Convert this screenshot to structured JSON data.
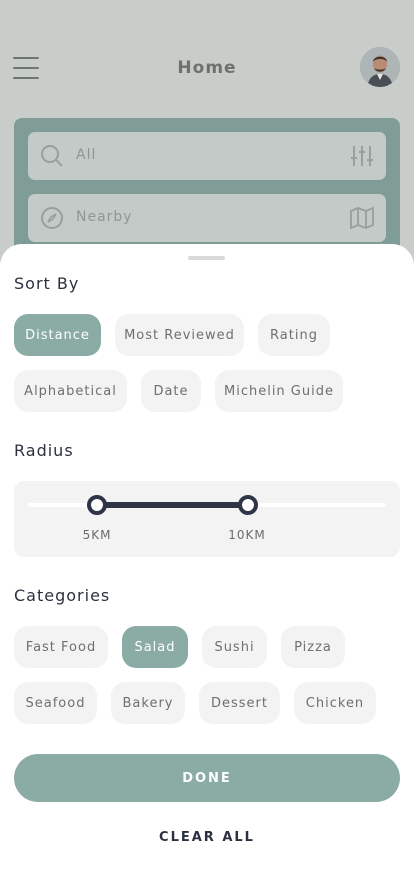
{
  "header": {
    "title": "Home",
    "menu_icon": "hamburger-menu-icon",
    "avatar_icon": "user-avatar"
  },
  "search": {
    "query_placeholder": "All",
    "location_placeholder": "Nearby",
    "search_icon": "search-icon",
    "filter_icon": "sliders-icon",
    "compass_icon": "compass-icon",
    "map_icon": "map-icon"
  },
  "sheet": {
    "sort_title": "Sort By",
    "sort_options": [
      {
        "label": "Distance",
        "selected": true
      },
      {
        "label": "Most Reviewed",
        "selected": false
      },
      {
        "label": "Rating",
        "selected": false
      },
      {
        "label": "Alphabetical",
        "selected": false
      },
      {
        "label": "Date",
        "selected": false
      },
      {
        "label": "Michelin Guide",
        "selected": false
      }
    ],
    "radius_title": "Radius",
    "radius": {
      "min_label": "5KM",
      "max_label": "10KM"
    },
    "categories_title": "Categories",
    "categories": [
      {
        "label": "Fast Food",
        "selected": false
      },
      {
        "label": "Salad",
        "selected": true
      },
      {
        "label": "Sushi",
        "selected": false
      },
      {
        "label": "Pizza",
        "selected": false
      },
      {
        "label": "Seafood",
        "selected": false
      },
      {
        "label": "Bakery",
        "selected": false
      },
      {
        "label": "Dessert",
        "selected": false
      },
      {
        "label": "Chicken",
        "selected": false
      }
    ],
    "done_label": "DONE",
    "clear_label": "CLEAR ALL"
  },
  "colors": {
    "accent": "#8aaca4",
    "slider": "#2f3446",
    "chip_bg": "#f3f3f3"
  }
}
